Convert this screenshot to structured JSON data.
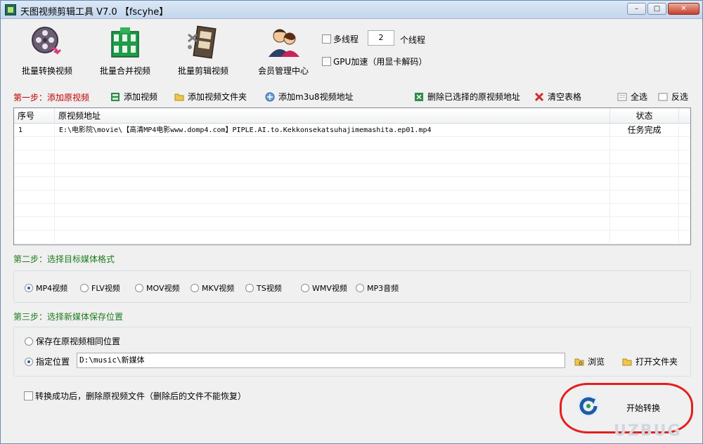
{
  "window": {
    "title": "天图视频剪辑工具 V7.0  【fscyhe】",
    "controls": {
      "minimize": "–",
      "maximize": "□",
      "close": "✕"
    }
  },
  "toolbar": {
    "batch_convert": "批量转换视频",
    "batch_merge": "批量合并视频",
    "batch_edit": "批量剪辑视频",
    "member_center": "会员管理中心"
  },
  "options": {
    "multithread_label": "多线程",
    "thread_count": "2",
    "thread_suffix": "个线程",
    "gpu_label": "GPU加速（用显卡解码）"
  },
  "step1": {
    "label": "第一步：添加原视频",
    "add_video": "添加视频",
    "add_folder": "添加视频文件夹",
    "add_m3u8": "添加m3u8视频地址",
    "delete_selected": "删除已选择的原视频地址",
    "clear_table": "清空表格",
    "select_all": "全选",
    "invert_select": "反选"
  },
  "table": {
    "headers": {
      "index": "序号",
      "path": "原视频地址",
      "status": "状态"
    },
    "rows": [
      {
        "index": "1",
        "path": "E:\\电影院\\movie\\【高清MP4电影www.domp4.com】PIPLE.AI.to.Kekkonsekatsuhajimemashita.ep01.mp4",
        "status": "任务完成"
      }
    ]
  },
  "step2": {
    "label": "第二步：选择目标媒体格式",
    "formats": [
      "MP4视频",
      "FLV视频",
      "MOV视频",
      "MKV视频",
      "TS视频",
      "WMV视频",
      "MP3音频"
    ],
    "selected": "MP4视频"
  },
  "step3": {
    "label": "第三步：选择新媒体保存位置",
    "same_location": "保存在原视频相同位置",
    "custom_location": "指定位置",
    "path_value": "D:\\music\\新媒体",
    "browse": "浏览",
    "open_folder": "打开文件夹"
  },
  "footer": {
    "delete_source": "转换成功后，删除原视频文件（删除后的文件不能恢复）",
    "start": "开始转换"
  },
  "watermark": "UZBUG"
}
